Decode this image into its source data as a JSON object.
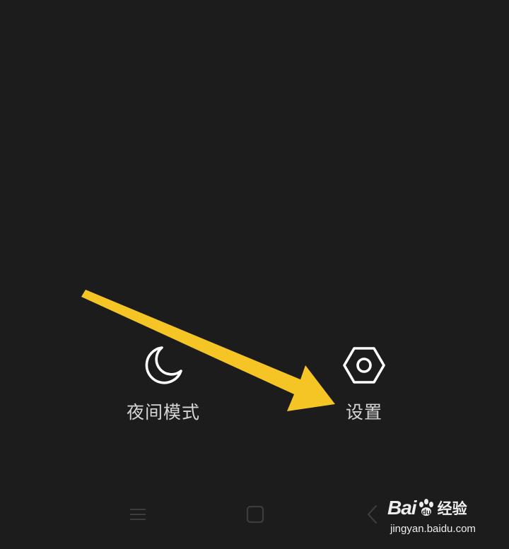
{
  "screen": {
    "background_color": "#1c1c1c",
    "label_color": "#d6d6d6",
    "annotation_arrow_color": "#f5c525"
  },
  "actions": {
    "night_mode": {
      "label": "夜间模式",
      "icon": "moon-icon"
    },
    "settings": {
      "label": "设置",
      "icon": "hexagon-nut-settings-icon"
    }
  },
  "nav_bar": {
    "menu_icon": "menu-lines-icon",
    "home_icon": "square-home-icon",
    "back_icon": "chevron-back-icon"
  },
  "watermark": {
    "brand_left": "Bai",
    "brand_right": "经验",
    "url": "jingyan.baidu.com"
  }
}
